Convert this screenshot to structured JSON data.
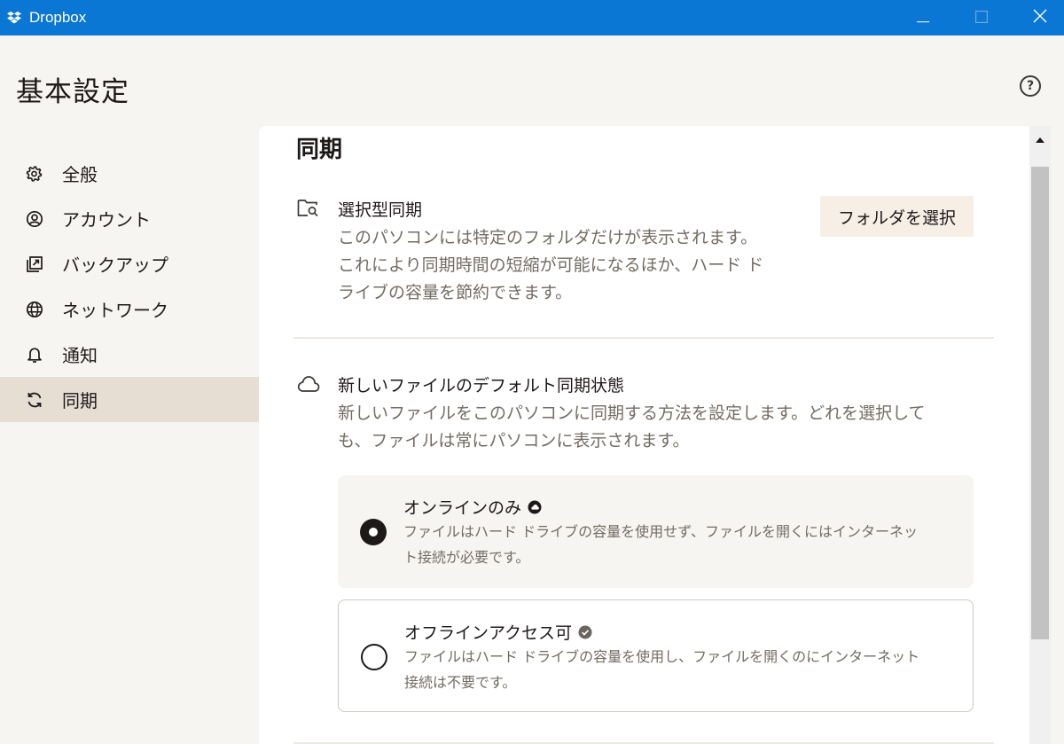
{
  "window": {
    "title": "Dropbox",
    "icon": "dropbox-icon",
    "accent": "#0a77d4"
  },
  "header": {
    "title": "基本設定",
    "help_icon": "help-circle-icon",
    "help_glyph": "?"
  },
  "sidebar": {
    "items": [
      {
        "label": "全般",
        "icon": "gear-icon"
      },
      {
        "label": "アカウント",
        "icon": "account-icon"
      },
      {
        "label": "バックアップ",
        "icon": "backup-icon"
      },
      {
        "label": "ネットワーク",
        "icon": "globe-icon"
      },
      {
        "label": "通知",
        "icon": "bell-icon"
      },
      {
        "label": "同期",
        "icon": "sync-icon",
        "active": true
      }
    ]
  },
  "main": {
    "section_title": "同期",
    "selective_sync": {
      "title": "選択型同期",
      "description_lines": [
        "このパソコンには特定のフォルダだけが表示されます。",
        "これにより同期時間の短縮が可能になるほか、ハード ド",
        "ライブの容量を節約できます。"
      ],
      "button_label": "フォルダを選択",
      "icon": "folder-search-icon"
    },
    "default_sync": {
      "title": "新しいファイルのデフォルト同期状態",
      "description_lines": [
        "新しいファイルをこのパソコンに同期する方法を設定します。どれを選択して",
        "も、ファイルは常にパソコンに表示されます。"
      ],
      "icon": "cloud-icon",
      "options": [
        {
          "title": "オンラインのみ",
          "badge_icon": "online-only-icon",
          "description_lines": [
            "ファイルはハード ドライブの容量を使用せず、ファイルを開くにはインターネッ",
            "ト接続が必要です。"
          ],
          "selected": true
        },
        {
          "title": "オフラインアクセス可",
          "badge_icon": "check-circle-icon",
          "description_lines": [
            "ファイルはハード ドライブの容量を使用し、ファイルを開くのにインターネット",
            "接続は不要です。"
          ],
          "selected": false
        }
      ]
    }
  }
}
